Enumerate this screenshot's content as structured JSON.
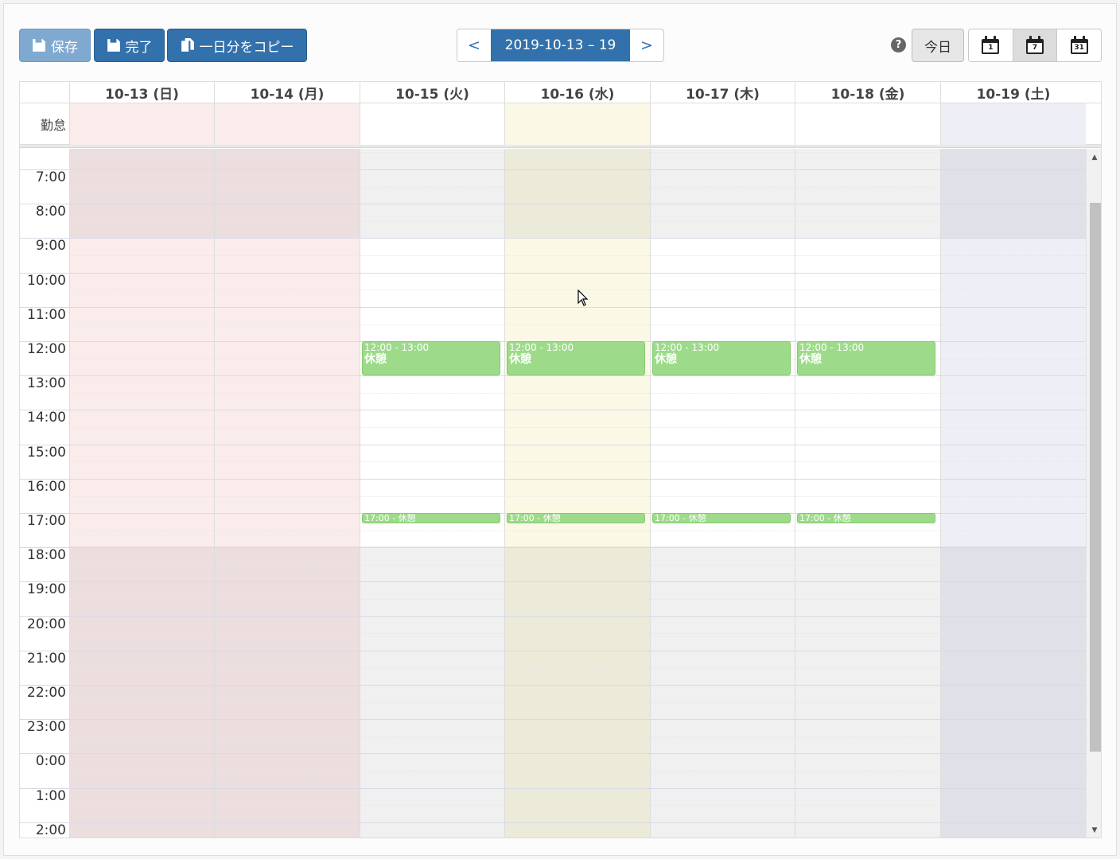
{
  "toolbar": {
    "save_label": "保存",
    "done_label": "完了",
    "copy_label": "一日分をコピー",
    "prev_label": "<",
    "range_label": "2019-10-13 – 19",
    "next_label": ">",
    "help_label": "?",
    "today_label": "今日",
    "view_day_num": "1",
    "view_week_num": "7",
    "view_month_num": "31"
  },
  "calendar": {
    "allday_label": "勤怠",
    "days": [
      {
        "label": "10-13 (日)",
        "tint": "#fbecec"
      },
      {
        "label": "10-14 (月)",
        "tint": "#fbecec"
      },
      {
        "label": "10-15 (火)",
        "tint": "#ffffff"
      },
      {
        "label": "10-16 (水)",
        "tint": "#fbf9e6"
      },
      {
        "label": "10-17 (木)",
        "tint": "#ffffff"
      },
      {
        "label": "10-18 (金)",
        "tint": "#ffffff"
      },
      {
        "label": "10-19 (土)",
        "tint": "#eeeef7"
      }
    ],
    "time_labels": [
      "7:00",
      "8:00",
      "9:00",
      "10:00",
      "11:00",
      "12:00",
      "13:00",
      "14:00",
      "15:00",
      "16:00",
      "17:00",
      "18:00",
      "19:00",
      "20:00",
      "21:00",
      "22:00",
      "23:00",
      "0:00",
      "1:00",
      "2:00"
    ],
    "break_event": {
      "time": "12:00 - 13:00",
      "title": "休憩"
    },
    "evening_event": {
      "text": "17:00 - 休憩"
    }
  },
  "colors": {
    "primary": "#3271ab",
    "event_green": "#9ddb8a"
  }
}
